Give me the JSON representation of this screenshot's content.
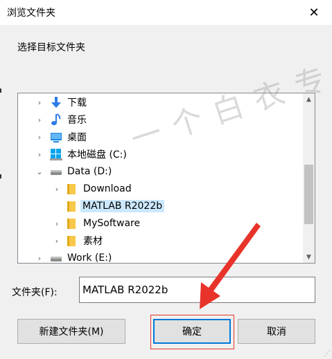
{
  "window": {
    "title": "浏览文件夹",
    "close_glyph": "✕"
  },
  "instruction": "选择目标文件夹",
  "tree": {
    "items": [
      {
        "label": "下载",
        "icon": "download-icon",
        "level": 1,
        "expander": "›"
      },
      {
        "label": "音乐",
        "icon": "music-icon",
        "level": 1,
        "expander": "›"
      },
      {
        "label": "桌面",
        "icon": "desktop-icon",
        "level": 1,
        "expander": "›"
      },
      {
        "label": "本地磁盘 (C:)",
        "icon": "windows-drive-icon",
        "level": 1,
        "expander": "›"
      },
      {
        "label": "Data (D:)",
        "icon": "drive-icon",
        "level": 1,
        "expander": "⌄",
        "expanded": true
      },
      {
        "label": "Download",
        "icon": "folder-icon",
        "level": 2,
        "expander": "›"
      },
      {
        "label": "MATLAB R2022b",
        "icon": "folder-icon",
        "level": 2,
        "expander": "",
        "selected": true
      },
      {
        "label": "MySoftware",
        "icon": "folder-icon",
        "level": 2,
        "expander": "›"
      },
      {
        "label": "素材",
        "icon": "folder-icon",
        "level": 2,
        "expander": "›"
      },
      {
        "label": "Work (E:)",
        "icon": "drive-icon",
        "level": 1,
        "expander": "›"
      }
    ],
    "scroll_up_glyph": "▲",
    "scroll_down_glyph": "▼"
  },
  "folder": {
    "label": "文件夹(F):",
    "value": "MATLAB R2022b"
  },
  "buttons": {
    "new_folder": "新建文件夹(M)",
    "ok": "确定",
    "cancel": "取消"
  },
  "watermark": "一个白衣专用",
  "colors": {
    "selection": "#cce8ff",
    "folder": "#f8c84a",
    "accent": "#0078d7",
    "annotation": "#e8332a"
  }
}
